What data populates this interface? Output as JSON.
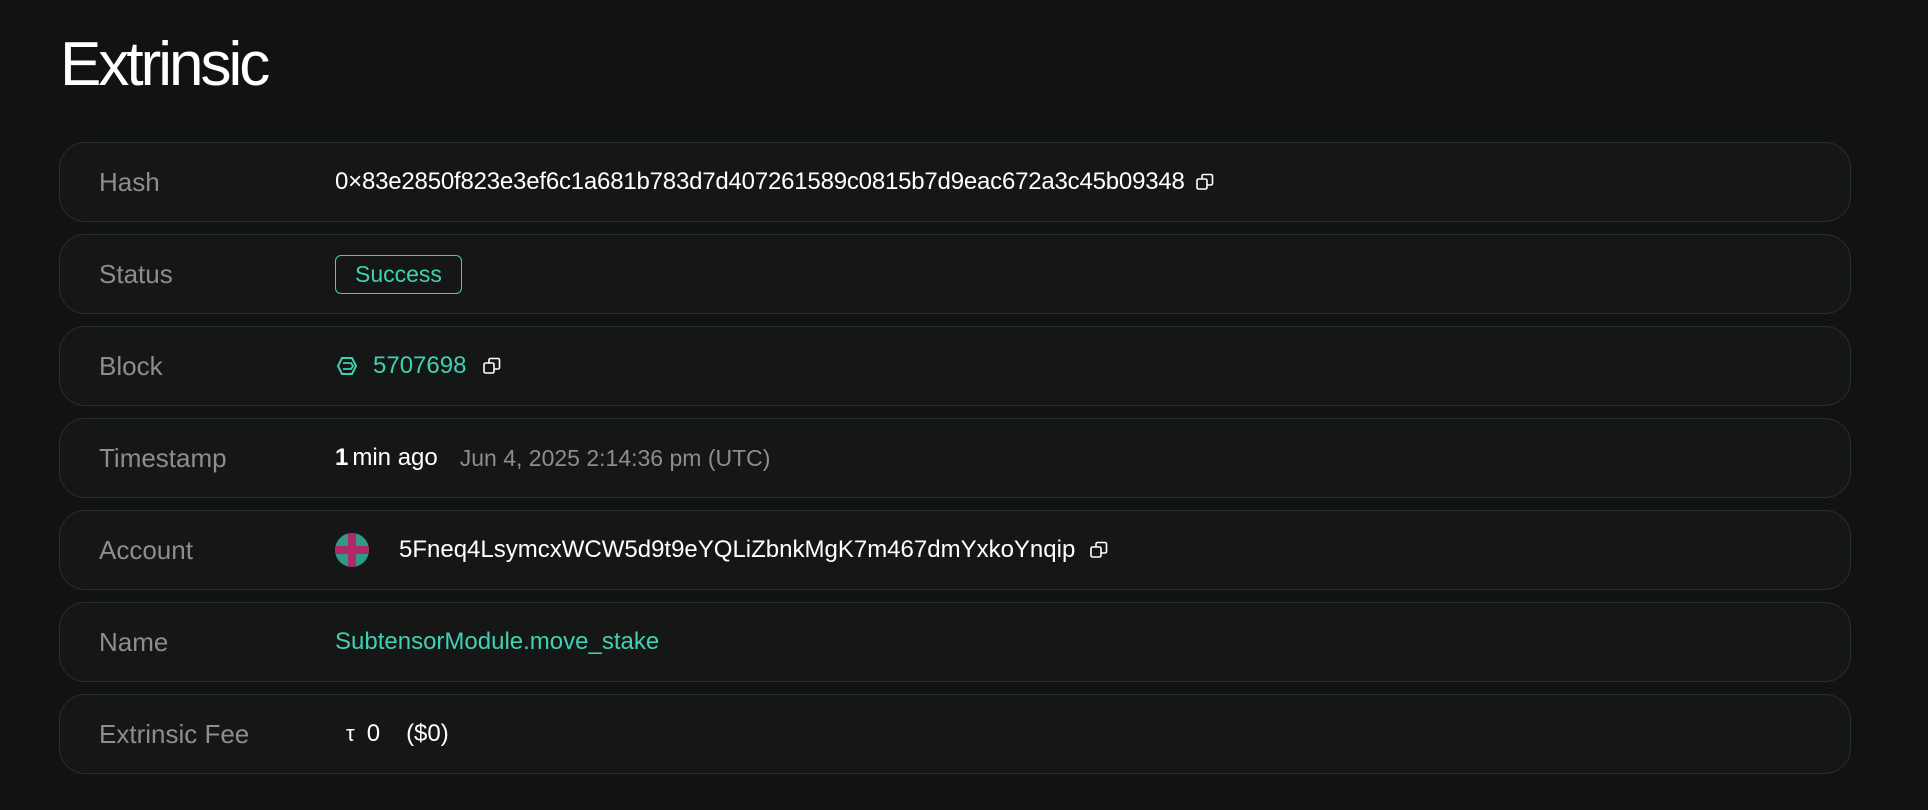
{
  "page": {
    "title": "Extrinsic"
  },
  "rows": {
    "hash": {
      "label": "Hash",
      "value": "0×83e2850f823e3ef6c1a681b783d7d407261589c0815b7d9eac672a3c45b09348",
      "icon": "copy-icon"
    },
    "status": {
      "label": "Status",
      "value": "Success",
      "color": "#3fd1b0"
    },
    "block": {
      "label": "Block",
      "value": "5707698",
      "icon": "block-cube-icon"
    },
    "timestamp": {
      "label": "Timestamp",
      "relative_num": "1",
      "relative_unit": "min ago",
      "full": "Jun 4, 2025 2:14:36 pm (UTC)"
    },
    "account": {
      "label": "Account",
      "value": "5Fneq4LsymcxWCW5d9t9eYQLiZbnkMgK7m467dmYxkoYnqip",
      "icon": "account-identicon"
    },
    "name": {
      "label": "Name",
      "value": "SubtensorModule.move_stake"
    },
    "fee": {
      "label": "Extrinsic Fee",
      "symbol": "τ",
      "amount": "0",
      "usd": "($0)"
    }
  },
  "colors": {
    "accent": "#3fd1b0",
    "background": "#111212",
    "row_background": "#151717",
    "row_border": "#2a2d2d",
    "muted_text": "#8b8e8d"
  }
}
